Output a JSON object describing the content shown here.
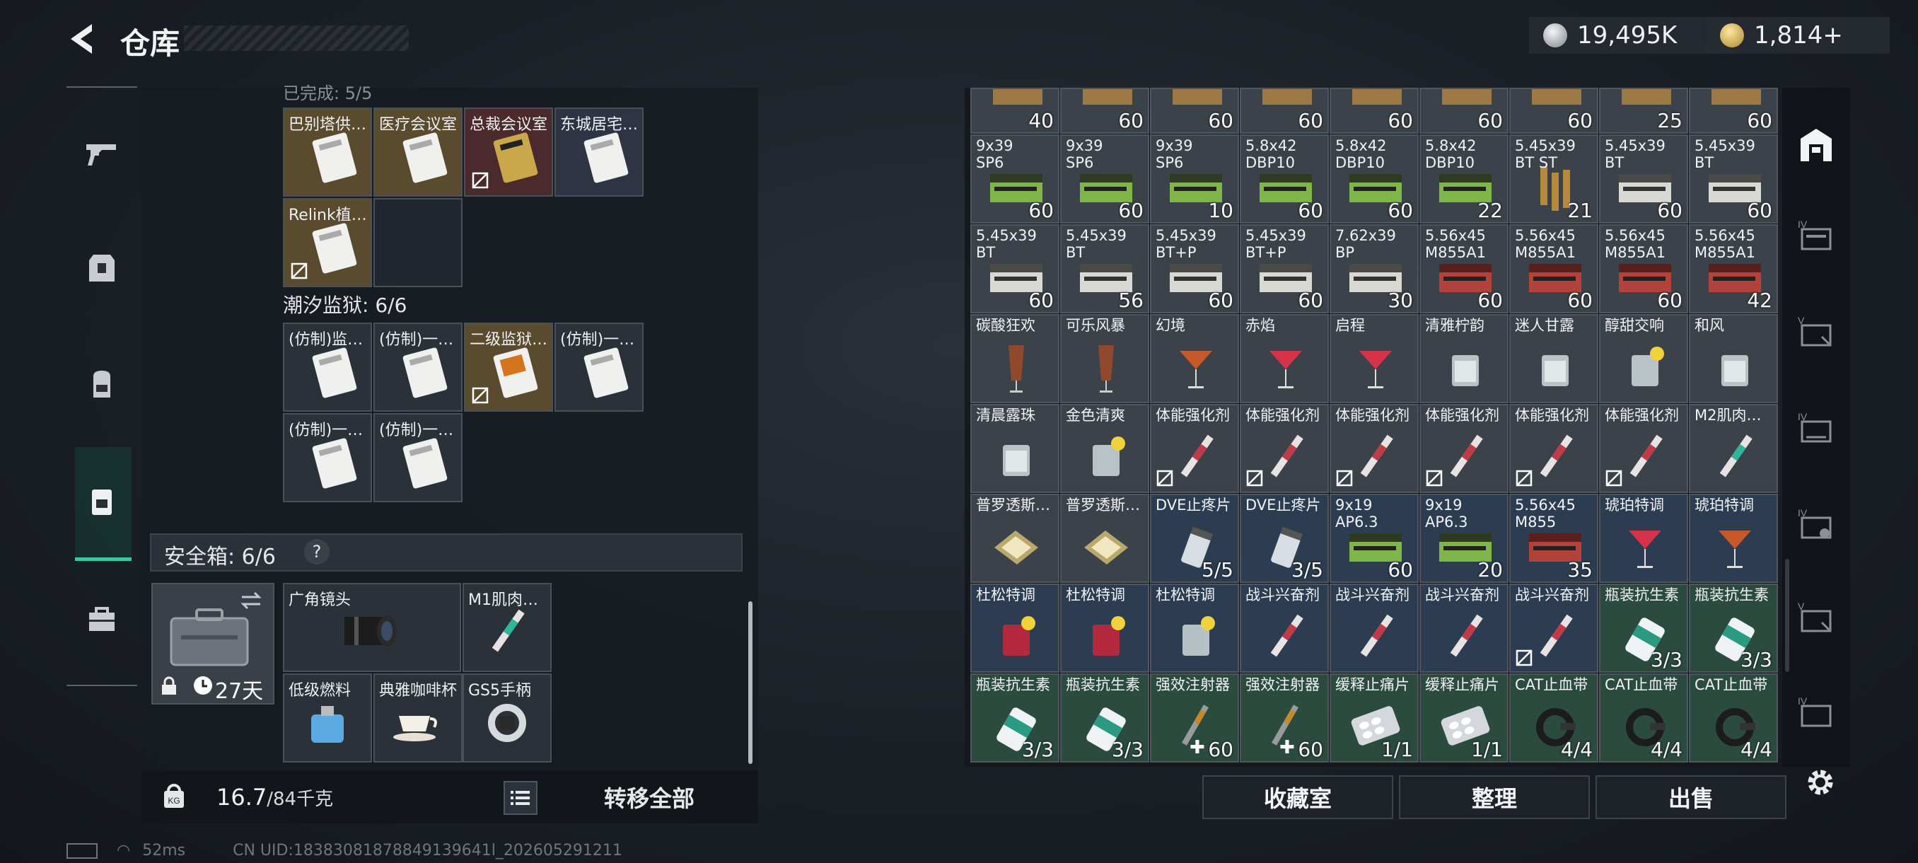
{
  "header": {
    "title": "仓库"
  },
  "currency": {
    "silver": "19,495K",
    "gold": "1,814+"
  },
  "left_panel": {
    "top_partial_label": "已完成: 5/5",
    "group1_items": [
      {
        "label": "巴别塔供…",
        "color": "gold"
      },
      {
        "label": "医疗会议室",
        "color": "gold"
      },
      {
        "label": "总裁会议室",
        "color": "red",
        "locked": true
      },
      {
        "label": "东城居宅…",
        "color": "blue"
      },
      {
        "label": "Relink植…",
        "color": "gold",
        "locked": true
      }
    ],
    "group2_label": "潮汐监狱: 6/6",
    "group2_items": [
      {
        "label": "(仿制)监…",
        "color": "gray"
      },
      {
        "label": "(仿制)一…",
        "color": "gray"
      },
      {
        "label": "二级监狱…",
        "color": "gold",
        "locked": true
      },
      {
        "label": "(仿制)一…",
        "color": "gray"
      },
      {
        "label": "(仿制)一…",
        "color": "gray"
      },
      {
        "label": "(仿制)一…",
        "color": "gray"
      }
    ],
    "safebox": {
      "label": "安全箱: 6/6",
      "help": "?",
      "days": "27天"
    },
    "safebox_items": [
      {
        "label": "广角镜头"
      },
      {
        "label": "M1肌肉…"
      },
      {
        "label": "低级燃料"
      },
      {
        "label": "典雅咖啡杯"
      },
      {
        "label": "GS5手柄"
      }
    ],
    "weight": "16.7",
    "weight_max": "/84千克",
    "transfer_all": "转移全部"
  },
  "right_panel": {
    "rows": [
      [
        {
          "label": "",
          "count": "40",
          "bg": "gray"
        },
        {
          "label": "",
          "count": "60",
          "bg": "gray"
        },
        {
          "label": "",
          "count": "60",
          "bg": "gray"
        },
        {
          "label": "",
          "count": "60",
          "bg": "gray"
        },
        {
          "label": "",
          "count": "60",
          "bg": "gray"
        },
        {
          "label": "",
          "count": "60",
          "bg": "gray"
        },
        {
          "label": "",
          "count": "60",
          "bg": "gray"
        },
        {
          "label": "",
          "count": "25",
          "bg": "gray"
        },
        {
          "label": "",
          "count": "60",
          "bg": "gray"
        }
      ],
      [
        {
          "label": "9x39\nSP6",
          "count": "60",
          "bg": "gray",
          "art": "green-ammo"
        },
        {
          "label": "9x39\nSP6",
          "count": "60",
          "bg": "gray",
          "art": "green-ammo"
        },
        {
          "label": "9x39\nSP6",
          "count": "10",
          "bg": "gray",
          "art": "green-ammo"
        },
        {
          "label": "5.8x42\nDBP10",
          "count": "60",
          "bg": "gray",
          "art": "green-ammo"
        },
        {
          "label": "5.8x42\nDBP10",
          "count": "60",
          "bg": "gray",
          "art": "green-ammo"
        },
        {
          "label": "5.8x42\nDBP10",
          "count": "22",
          "bg": "gray",
          "art": "green-ammo"
        },
        {
          "label": "5.45x39\nBT ST",
          "count": "21",
          "bg": "gray",
          "art": "rounds"
        },
        {
          "label": "5.45x39\nBT",
          "count": "60",
          "bg": "gray",
          "art": "white-ammo"
        },
        {
          "label": "5.45x39\nBT",
          "count": "60",
          "bg": "gray",
          "art": "white-ammo"
        }
      ],
      [
        {
          "label": "5.45x39\nBT",
          "count": "60",
          "bg": "gray",
          "art": "white-ammo"
        },
        {
          "label": "5.45x39\nBT",
          "count": "56",
          "bg": "gray",
          "art": "white-ammo"
        },
        {
          "label": "5.45x39\nBT+P",
          "count": "60",
          "bg": "gray",
          "art": "white-ammo"
        },
        {
          "label": "5.45x39\nBT+P",
          "count": "60",
          "bg": "gray",
          "art": "white-ammo"
        },
        {
          "label": "7.62x39\nBP",
          "count": "30",
          "bg": "gray",
          "art": "white-ammo"
        },
        {
          "label": "5.56x45\nM855A1",
          "count": "60",
          "bg": "gray",
          "art": "red-ammo"
        },
        {
          "label": "5.56x45\nM855A1",
          "count": "60",
          "bg": "gray",
          "art": "red-ammo"
        },
        {
          "label": "5.56x45\nM855A1",
          "count": "60",
          "bg": "gray",
          "art": "red-ammo"
        },
        {
          "label": "5.56x45\nM855A1",
          "count": "42",
          "bg": "gray",
          "art": "red-ammo"
        }
      ],
      [
        {
          "label": "碳酸狂欢",
          "count": "",
          "bg": "gray",
          "art": "tall-glass"
        },
        {
          "label": "可乐风暴",
          "count": "",
          "bg": "gray",
          "art": "tall-glass"
        },
        {
          "label": "幻境",
          "count": "",
          "bg": "gray",
          "art": "martini-orange"
        },
        {
          "label": "赤焰",
          "count": "",
          "bg": "gray",
          "art": "martini-red"
        },
        {
          "label": "启程",
          "count": "",
          "bg": "gray",
          "art": "martini-red"
        },
        {
          "label": "清雅柠韵",
          "count": "",
          "bg": "gray",
          "art": "rocks"
        },
        {
          "label": "迷人甘露",
          "count": "",
          "bg": "gray",
          "art": "rocks"
        },
        {
          "label": "醇甜交响",
          "count": "",
          "bg": "gray",
          "art": "rocks-lemon"
        },
        {
          "label": "和风",
          "count": "",
          "bg": "gray",
          "art": "rocks"
        }
      ],
      [
        {
          "label": "清晨露珠",
          "count": "",
          "bg": "gray",
          "art": "rocks"
        },
        {
          "label": "金色清爽",
          "count": "",
          "bg": "gray",
          "art": "rocks-lemon"
        },
        {
          "label": "体能强化剂",
          "count": "",
          "bg": "gray",
          "art": "syringe-red",
          "locked": true
        },
        {
          "label": "体能强化剂",
          "count": "",
          "bg": "gray",
          "art": "syringe-red",
          "locked": true
        },
        {
          "label": "体能强化剂",
          "count": "",
          "bg": "gray",
          "art": "syringe-red",
          "locked": true
        },
        {
          "label": "体能强化剂",
          "count": "",
          "bg": "gray",
          "art": "syringe-red",
          "locked": true
        },
        {
          "label": "体能强化剂",
          "count": "",
          "bg": "gray",
          "art": "syringe-red",
          "locked": true
        },
        {
          "label": "体能强化剂",
          "count": "",
          "bg": "gray",
          "art": "syringe-red",
          "locked": true
        },
        {
          "label": "M2肌肉…",
          "count": "",
          "bg": "gray",
          "art": "syringe-green"
        }
      ],
      [
        {
          "label": "普罗透斯…",
          "count": "",
          "bg": "gray",
          "art": "pouch"
        },
        {
          "label": "普罗透斯…",
          "count": "",
          "bg": "gray",
          "art": "pouch"
        },
        {
          "label": "DVE止疼片",
          "count": "5/5",
          "bg": "blue",
          "art": "pill-bottle"
        },
        {
          "label": "DVE止疼片",
          "count": "3/5",
          "bg": "blue",
          "art": "pill-bottle"
        },
        {
          "label": "9x19\nAP6.3",
          "count": "60",
          "bg": "blue",
          "art": "green-ammo"
        },
        {
          "label": "9x19\nAP6.3",
          "count": "20",
          "bg": "blue",
          "art": "green-ammo"
        },
        {
          "label": "5.56x45\nM855",
          "count": "35",
          "bg": "blue",
          "art": "red-ammo"
        },
        {
          "label": "琥珀特调",
          "count": "",
          "bg": "blue",
          "art": "martini-red"
        },
        {
          "label": "琥珀特调",
          "count": "",
          "bg": "blue",
          "art": "martini-orange"
        }
      ],
      [
        {
          "label": "杜松特调",
          "count": "",
          "bg": "blue",
          "art": "rocks-red"
        },
        {
          "label": "杜松特调",
          "count": "",
          "bg": "blue",
          "art": "rocks-red"
        },
        {
          "label": "杜松特调",
          "count": "",
          "bg": "blue",
          "art": "rocks-lemon"
        },
        {
          "label": "战斗兴奋剂",
          "count": "",
          "bg": "blue",
          "art": "syringe-red"
        },
        {
          "label": "战斗兴奋剂",
          "count": "",
          "bg": "blue",
          "art": "syringe-red"
        },
        {
          "label": "战斗兴奋剂",
          "count": "",
          "bg": "blue",
          "art": "syringe-red"
        },
        {
          "label": "战斗兴奋剂",
          "count": "",
          "bg": "blue",
          "art": "syringe-red",
          "locked": true
        },
        {
          "label": "瓶装抗生素",
          "count": "3/3",
          "bg": "green",
          "art": "antibiotic"
        },
        {
          "label": "瓶装抗生素",
          "count": "3/3",
          "bg": "green",
          "art": "antibiotic"
        }
      ],
      [
        {
          "label": "瓶装抗生素",
          "count": "3/3",
          "bg": "green",
          "art": "antibiotic"
        },
        {
          "label": "瓶装抗生素",
          "count": "3/3",
          "bg": "green",
          "art": "antibiotic"
        },
        {
          "label": "强效注射器",
          "count": "60",
          "bg": "green",
          "art": "injector",
          "plus": true
        },
        {
          "label": "强效注射器",
          "count": "60",
          "bg": "green",
          "art": "injector",
          "plus": true
        },
        {
          "label": "缓释止痛片",
          "count": "1/1",
          "bg": "green",
          "art": "blister"
        },
        {
          "label": "缓释止痛片",
          "count": "1/1",
          "bg": "green",
          "art": "blister"
        },
        {
          "label": "CAT止血带",
          "count": "4/4",
          "bg": "green",
          "art": "tourniquet"
        },
        {
          "label": "CAT止血带",
          "count": "4/4",
          "bg": "green",
          "art": "tourniquet"
        },
        {
          "label": "CAT止血带",
          "count": "4/4",
          "bg": "green",
          "art": "tourniquet"
        }
      ]
    ],
    "buttons": {
      "collection": "收藏室",
      "sort": "整理",
      "sell": "出售"
    }
  },
  "footer": {
    "ping": "52ms",
    "uid": "CN UID:18383081878849139641l_202605291211"
  }
}
